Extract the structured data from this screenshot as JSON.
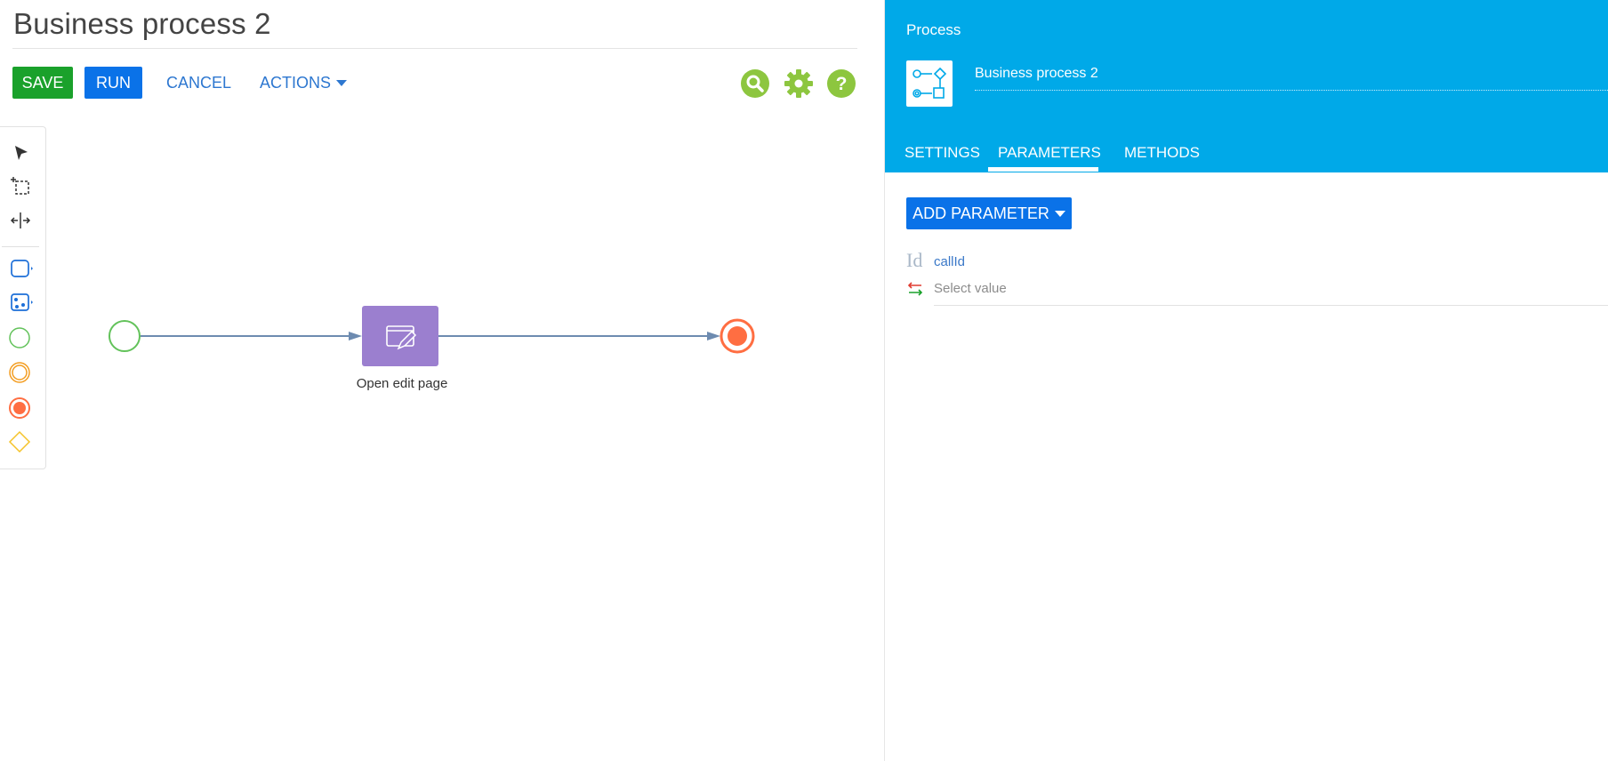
{
  "designer": {
    "title": "Business process 2",
    "save_label": "SAVE",
    "run_label": "RUN",
    "cancel_label": "CANCEL",
    "actions_label": "ACTIONS",
    "top_icons": [
      "search-icon",
      "gear-icon",
      "help-icon"
    ]
  },
  "toolbox": {
    "tools": [
      "pointer-tool",
      "lasso-select-tool",
      "space-tool",
      "task-tool",
      "subprocess-tool",
      "start-event-tool",
      "intermediate-event-tool",
      "end-event-tool",
      "gateway-tool"
    ]
  },
  "diagram": {
    "task_label": "Open edit page"
  },
  "panel": {
    "caption": "Process",
    "process_name": "Business process 2",
    "tabs": [
      {
        "label": "SETTINGS",
        "active": false
      },
      {
        "label": "PARAMETERS",
        "active": true
      },
      {
        "label": "METHODS",
        "active": false
      }
    ],
    "add_parameter_label": "ADD PARAMETER",
    "parameter": {
      "type_label": "Id",
      "name": "callId",
      "value_placeholder": "Select value"
    }
  },
  "colors": {
    "save": "#1aa12b",
    "primary": "#0a72e8",
    "header": "#00a9e8",
    "task": "#9b7fcf",
    "start": "#62c25a",
    "end": "#ff6e42",
    "icons": "#8dc63f"
  }
}
